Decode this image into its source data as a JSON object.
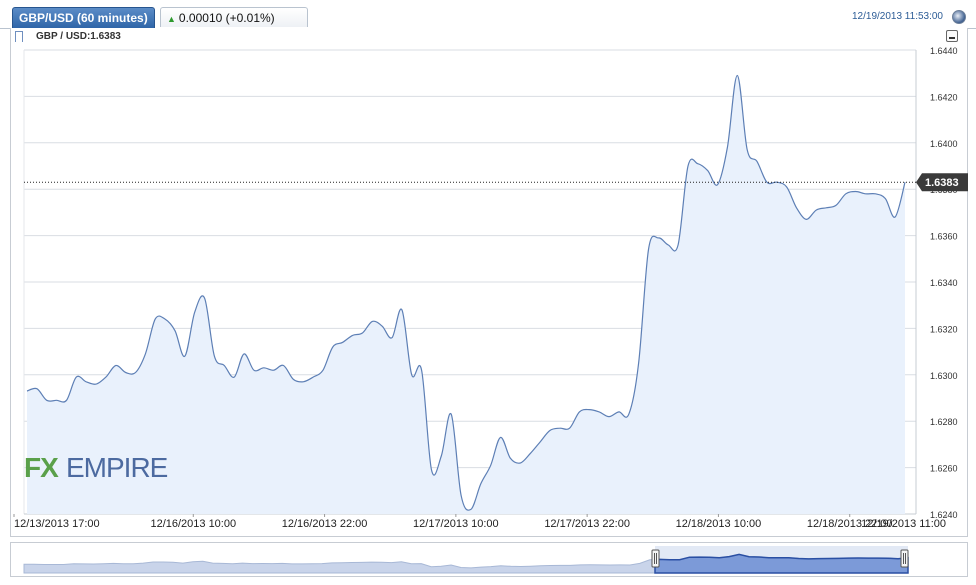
{
  "header": {
    "tab_title": "GBP/USD (60 minutes)",
    "change_text": "0.00010 (+0.01%)",
    "timestamp": "12/19/2013 11:53:00"
  },
  "series_label": "GBP / USD:1.6383",
  "logo_text": "FXEMPIRE",
  "colors": {
    "line": "#5d7fb5",
    "fill": "#e9f1fc",
    "accent": "#2f65a8",
    "logo_fx": "#5aa04a",
    "logo_empire": "#4c6aa0"
  },
  "chart_data": {
    "type": "area",
    "title": "",
    "xlabel": "",
    "ylabel": "",
    "ylim": [
      1.624,
      1.644
    ],
    "y_ticks": [
      "1.6440",
      "1.6420",
      "1.6400",
      "1.6380",
      "1.6360",
      "1.6340",
      "1.6320",
      "1.6300",
      "1.6280",
      "1.6260",
      "1.6240"
    ],
    "x_tick_labels": [
      "12/13/2013 17:00",
      "12/16/2013 10:00",
      "12/16/2013 22:00",
      "12/17/2013 10:00",
      "12/17/2013 22:00",
      "12/18/2013 10:00",
      "12/18/2013 22:00",
      "12/19/2013 11:00"
    ],
    "current_value": "1.6383",
    "grid": true,
    "series": [
      {
        "values": [
          1.6293,
          1.6294,
          1.6289,
          1.6289,
          1.6289,
          1.6299,
          1.6297,
          1.6296,
          1.6299,
          1.6304,
          1.6301,
          1.6301,
          1.6309,
          1.6324,
          1.6324,
          1.6319,
          1.6308,
          1.6327,
          1.6333,
          1.6308,
          1.6304,
          1.6299,
          1.6309,
          1.6302,
          1.6303,
          1.6302,
          1.6304,
          1.6298,
          1.6297,
          1.6299,
          1.6302,
          1.6312,
          1.6314,
          1.6317,
          1.6318,
          1.6323,
          1.6321,
          1.6316,
          1.6328,
          1.63,
          1.6302,
          1.6259,
          1.6265,
          1.6283,
          1.6248,
          1.6242,
          1.6253,
          1.6261,
          1.6273,
          1.6264,
          1.6262,
          1.6266,
          1.6271,
          1.6276,
          1.6277,
          1.6277,
          1.6284,
          1.6285,
          1.6284,
          1.6282,
          1.6284,
          1.6283,
          1.6305,
          1.6354,
          1.6359,
          1.6356,
          1.6356,
          1.639,
          1.6391,
          1.6388,
          1.6382,
          1.6398,
          1.6429,
          1.6397,
          1.6392,
          1.6383,
          1.6383,
          1.6381,
          1.6372,
          1.6367,
          1.6371,
          1.6372,
          1.6373,
          1.6378,
          1.6379,
          1.6378,
          1.6378,
          1.6376,
          1.6368,
          1.6383
        ]
      }
    ]
  }
}
